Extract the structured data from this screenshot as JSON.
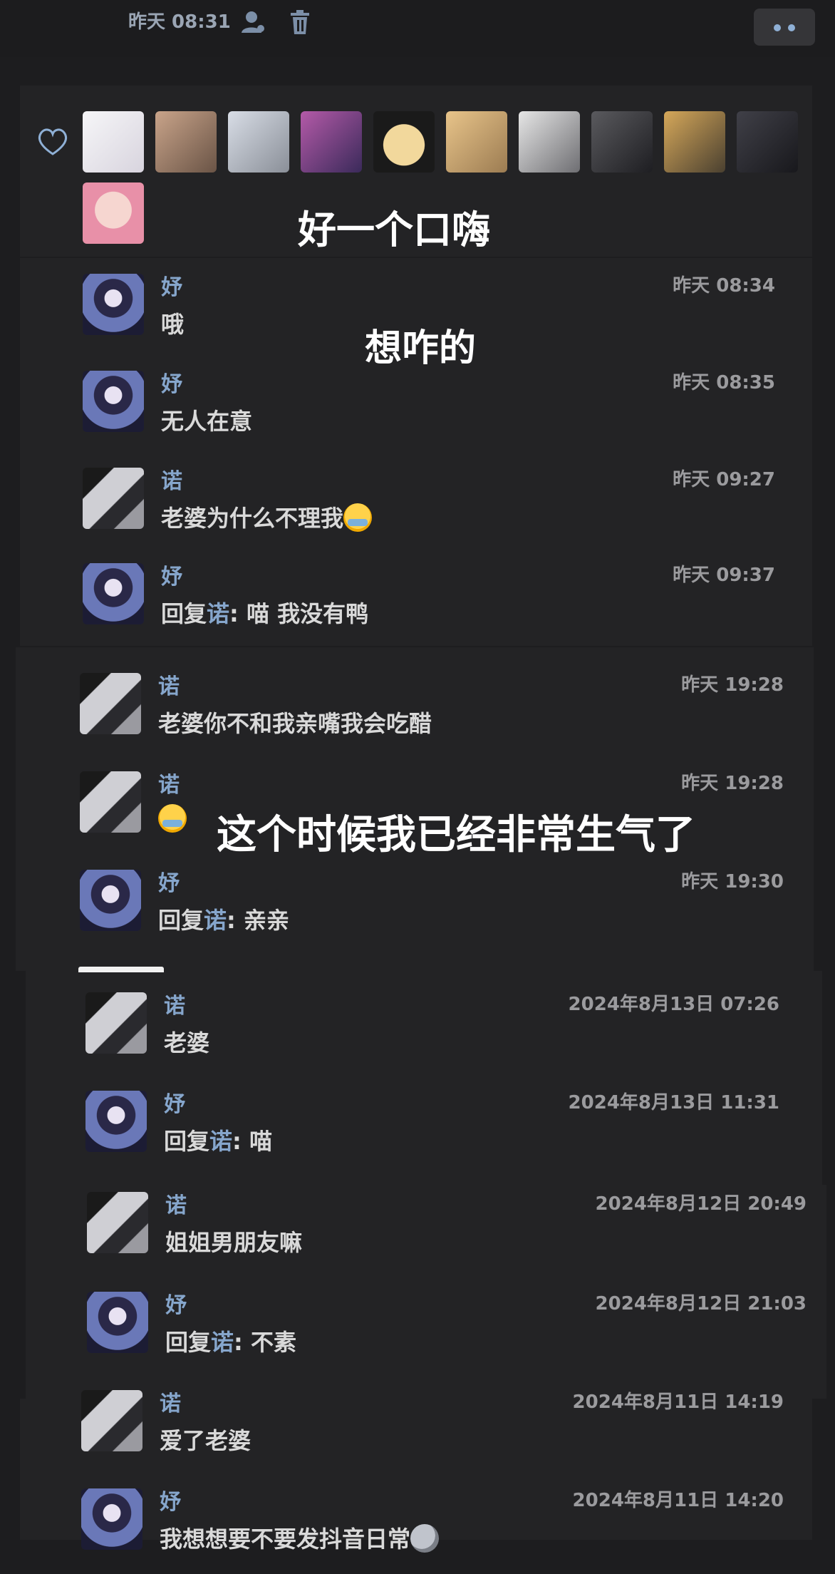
{
  "header": {
    "time": "昨天 08:31"
  },
  "likes": {
    "caption": "好一个口嗨"
  },
  "overlays": {
    "caption_2": "想咋的",
    "caption_3": "这个时候我已经非常生气了"
  },
  "comments": [
    {
      "name": "妤",
      "time": "昨天 08:34",
      "text": "哦",
      "reply_to": null,
      "emoji": null,
      "avatar": "avatar-girl"
    },
    {
      "name": "妤",
      "time": "昨天 08:35",
      "text": "无人在意",
      "reply_to": null,
      "emoji": null,
      "avatar": "avatar-girl"
    },
    {
      "name": "诺",
      "time": "昨天 09:27",
      "text": "老婆为什么不理我",
      "reply_to": null,
      "emoji": "crying-face-emoji",
      "avatar": "avatar-boy"
    },
    {
      "name": "妤",
      "time": "昨天 09:37",
      "text": "喵 我没有鸭",
      "reply_prefix": "回复",
      "reply_to": "诺",
      "emoji": null,
      "avatar": "avatar-girl"
    },
    {
      "name": "诺",
      "time": "昨天 19:28",
      "text": "老婆你不和我亲嘴我会吃醋",
      "reply_to": null,
      "emoji": null,
      "avatar": "avatar-boy"
    },
    {
      "name": "诺",
      "time": "昨天 19:28",
      "text": "",
      "reply_to": null,
      "emoji": "crying-face-emoji",
      "avatar": "avatar-boy"
    },
    {
      "name": "妤",
      "time": "昨天 19:30",
      "text": "亲亲",
      "reply_prefix": "回复",
      "reply_to": "诺",
      "emoji": null,
      "avatar": "avatar-girl"
    },
    {
      "name": "诺",
      "time": "2024年8月13日 07:26",
      "text": "老婆",
      "reply_to": null,
      "emoji": null,
      "avatar": "avatar-boy"
    },
    {
      "name": "妤",
      "time": "2024年8月13日 11:31",
      "text": "喵",
      "reply_prefix": "回复",
      "reply_to": "诺",
      "emoji": null,
      "avatar": "avatar-girl"
    },
    {
      "name": "诺",
      "time": "2024年8月12日 20:49",
      "text": "姐姐男朋友嘛",
      "reply_to": null,
      "emoji": null,
      "avatar": "avatar-boy"
    },
    {
      "name": "妤",
      "time": "2024年8月12日 21:03",
      "text": "不素",
      "reply_prefix": "回复",
      "reply_to": "诺",
      "emoji": null,
      "avatar": "avatar-girl"
    },
    {
      "name": "诺",
      "time": "2024年8月11日 14:19",
      "text": "爱了老婆",
      "reply_to": null,
      "emoji": null,
      "avatar": "avatar-boy"
    },
    {
      "name": "妤",
      "time": "2024年8月11日 14:20",
      "text": "我想想要不要发抖音日常",
      "reply_to": null,
      "emoji": "moon-face-emoji",
      "avatar": "avatar-girl"
    }
  ],
  "colors": {
    "background": "#1d1d1f",
    "panel": "#232325",
    "accent": "#86a6cc",
    "time": "#9b9b9e"
  }
}
